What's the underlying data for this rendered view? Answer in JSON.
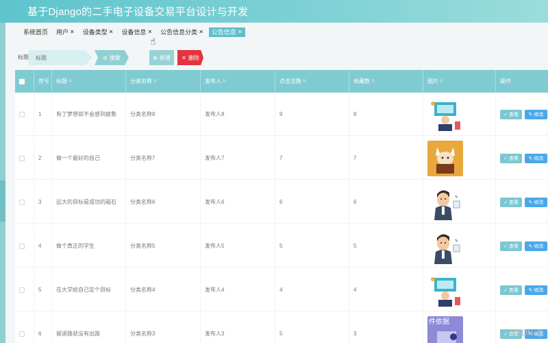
{
  "header": {
    "title": "基于Django的二手电子设备交易平台设计与开发"
  },
  "tabs": [
    {
      "label": "系统首页",
      "closable": false
    },
    {
      "label": "用户",
      "closable": true
    },
    {
      "label": "设备类型",
      "closable": true
    },
    {
      "label": "设备信息",
      "closable": true
    },
    {
      "label": "公告信息分类",
      "closable": true
    },
    {
      "label": "公告信息",
      "closable": true,
      "active": true
    }
  ],
  "search": {
    "label": "标题",
    "placeholder": "标题",
    "search_label": "搜索",
    "add_label": "新增",
    "delete_label": "删除"
  },
  "table": {
    "columns": [
      "序号",
      "标题",
      "分类名称",
      "发布人",
      "点击次数",
      "收藏数",
      "图片",
      "操作"
    ],
    "view_label": "查看",
    "edit_label": "修改",
    "rows": [
      {
        "index": "1",
        "title": "有了梦想就不会感到疲惫",
        "category": "分类名称8",
        "publisher": "发布人8",
        "clicks": "9",
        "favorites": "8",
        "image": "cartoon-classroom"
      },
      {
        "index": "2",
        "title": "做一个最好的自己",
        "category": "分类名称7",
        "publisher": "发布人7",
        "clicks": "7",
        "favorites": "7",
        "image": "cartoon-dog"
      },
      {
        "index": "3",
        "title": "远大的目标是成功的磁石",
        "category": "分类名称6",
        "publisher": "发布人6",
        "clicks": "6",
        "favorites": "6",
        "image": "cartoon-man"
      },
      {
        "index": "4",
        "title": "做个真正的学生",
        "category": "分类名称5",
        "publisher": "发布人5",
        "clicks": "5",
        "favorites": "5",
        "image": "cartoon-man-big"
      },
      {
        "index": "5",
        "title": "在大学给自己定个目标",
        "category": "分类名称4",
        "publisher": "发布人4",
        "clicks": "4",
        "favorites": "4",
        "image": "cartoon-classroom"
      },
      {
        "index": "6",
        "title": "留退路就没有出路",
        "category": "分类名称3",
        "publisher": "发布人3",
        "clicks": "5",
        "favorites": "3",
        "image": "cartoon-document",
        "image_text": "件依据"
      }
    ]
  },
  "watermark": "CSDN @",
  "colors": {
    "header": "#5ec4cc",
    "table_header": "#7fcbd1",
    "delete": "#e5323d",
    "edit": "#4aa8ea",
    "view": "#7cc7d1",
    "active_tab": "#5fbfc9"
  }
}
